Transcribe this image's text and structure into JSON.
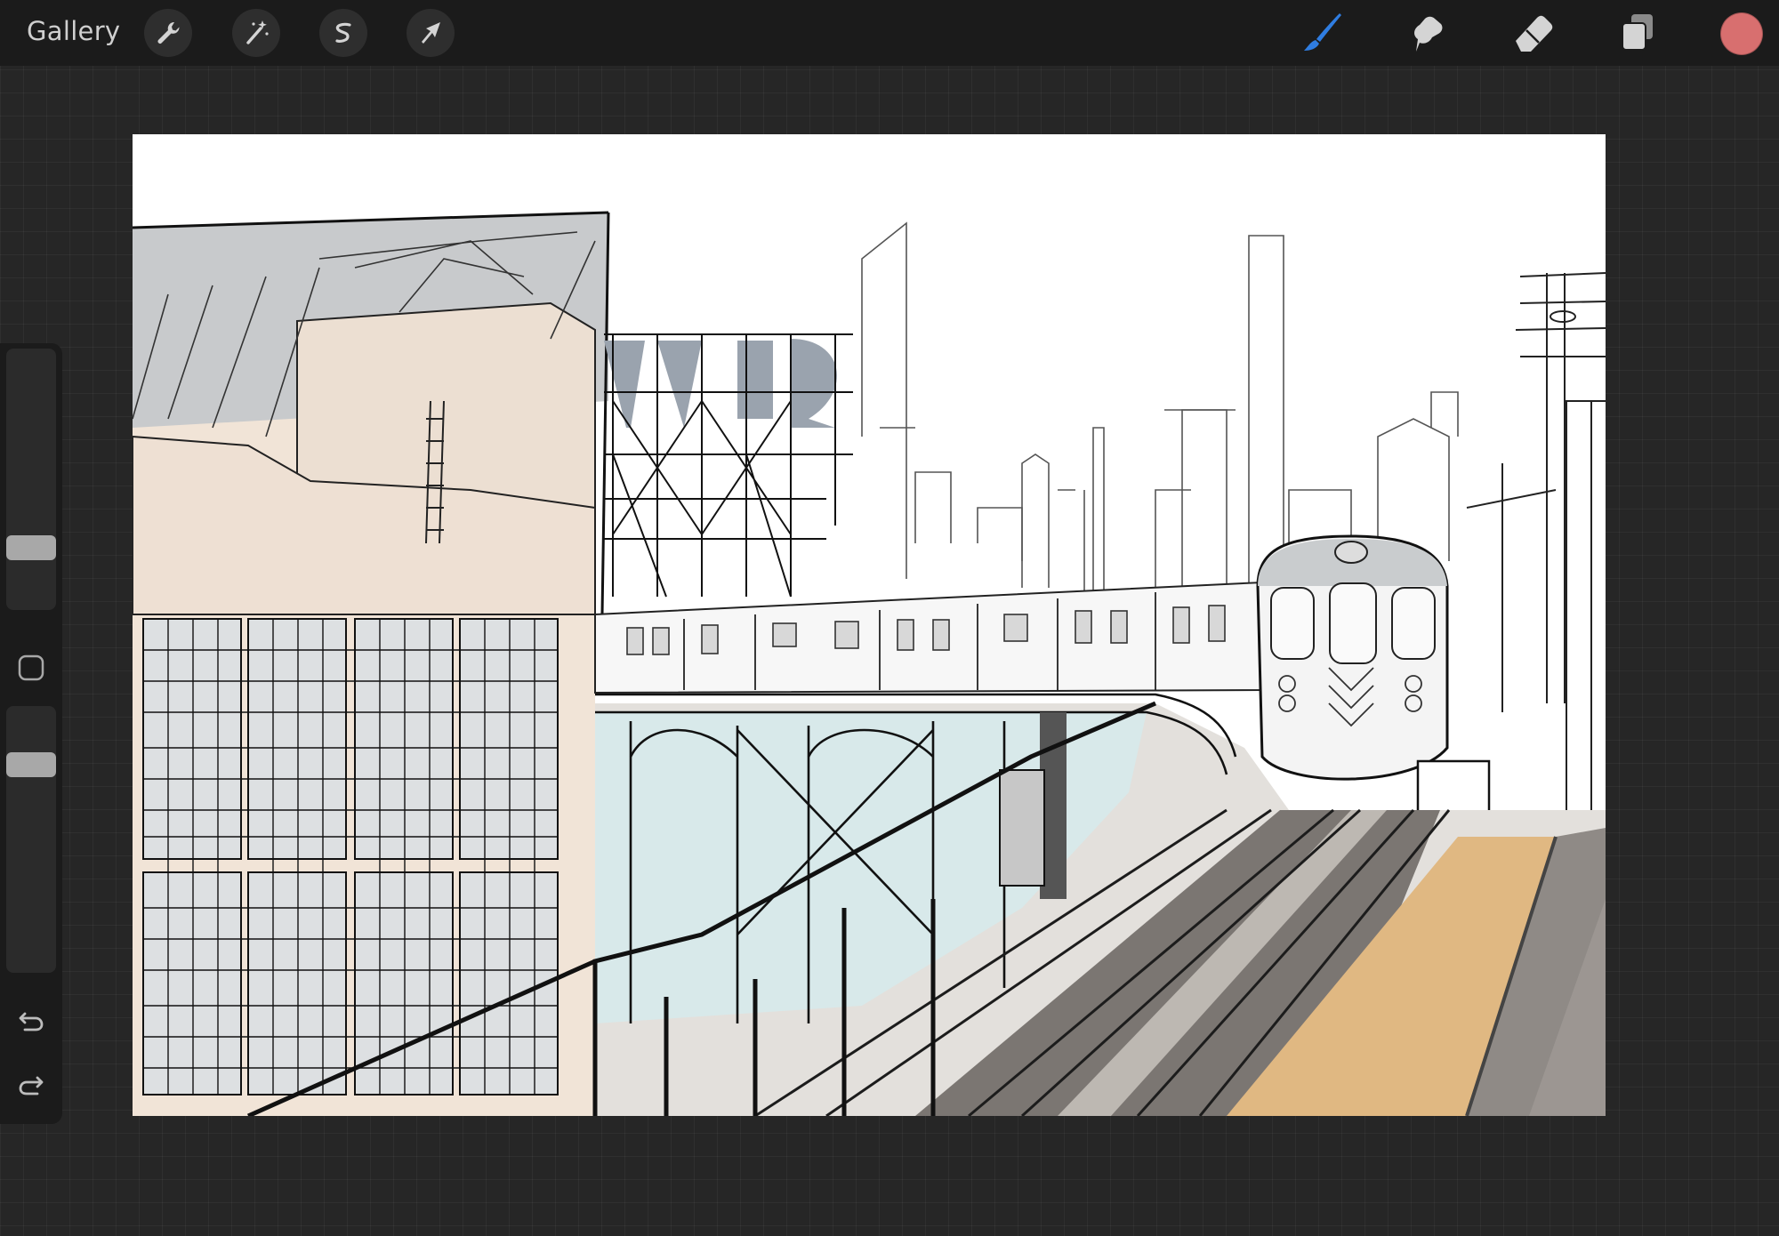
{
  "topbar": {
    "gallery_label": "Gallery",
    "left_tools": [
      {
        "name": "actions",
        "icon": "wrench-icon"
      },
      {
        "name": "adjustments",
        "icon": "magic-wand-icon"
      },
      {
        "name": "selection",
        "icon": "selection-icon"
      },
      {
        "name": "transform",
        "icon": "arrow-cursor-icon"
      }
    ],
    "right_tools": [
      {
        "name": "brush",
        "icon": "brush-icon",
        "active": true,
        "color": "#2f7de1"
      },
      {
        "name": "smudge",
        "icon": "smudge-icon"
      },
      {
        "name": "eraser",
        "icon": "eraser-icon"
      },
      {
        "name": "layers",
        "icon": "layers-icon"
      }
    ],
    "current_color": "#d86f6f"
  },
  "sidebar": {
    "brush_size_level": 0.74,
    "opacity_level": 0.66,
    "tools": [
      "modifier-square-icon",
      "undo-icon",
      "redo-icon"
    ]
  },
  "canvas": {
    "artwork": "sketch-elevated-train-station"
  }
}
